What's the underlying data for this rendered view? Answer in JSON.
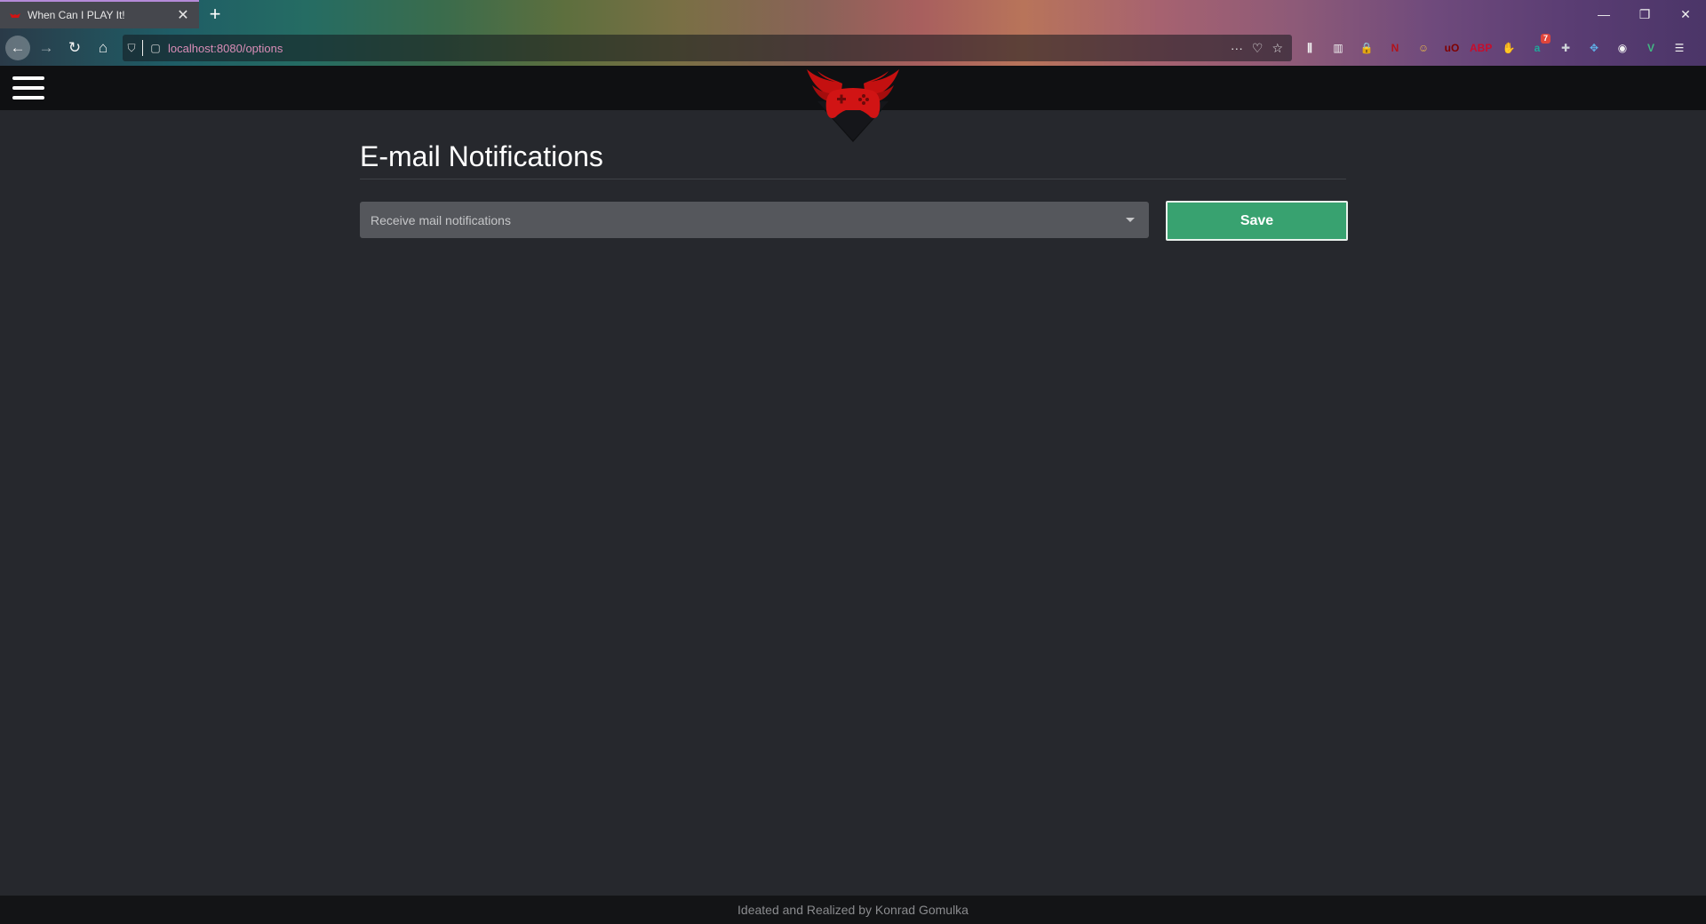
{
  "browser": {
    "tab_title": "When Can I PLAY It!",
    "tab_close": "✕",
    "new_tab": "+",
    "window_controls": {
      "minimize": "—",
      "restore": "❐",
      "close": "✕"
    },
    "nav": {
      "back": "←",
      "forward": "→",
      "reload": "↻",
      "home": "⌂"
    },
    "url": "localhost:8080/options",
    "url_actions": {
      "more": "···",
      "pocket": "♡",
      "bookmark": "☆"
    },
    "extensions": [
      {
        "icon": "library-icon",
        "label": "⫼"
      },
      {
        "icon": "sidebar-icon",
        "label": "▥"
      },
      {
        "icon": "lock-ext-icon",
        "label": "🔒",
        "color": "#e0453b"
      },
      {
        "icon": "netflix-ext-icon",
        "label": "N",
        "color": "#b3131b"
      },
      {
        "icon": "face-ext-icon",
        "label": "☺",
        "color": "#e8b84a"
      },
      {
        "icon": "ublock-icon",
        "label": "uO",
        "color": "#800000"
      },
      {
        "icon": "adblock-plus-icon",
        "label": "ABP",
        "color": "#c70d2c"
      },
      {
        "icon": "hand-ext-icon",
        "label": "✋",
        "color": "#e0453b"
      },
      {
        "icon": "a-ext-icon",
        "label": "a",
        "color": "#1fa89b",
        "badge": "7"
      },
      {
        "icon": "puzzle-ext-icon",
        "label": "✚",
        "color": "#cfd4d9"
      },
      {
        "icon": "gamepad-ext-icon",
        "label": "✥",
        "color": "#5fb0e8"
      },
      {
        "icon": "account-icon",
        "label": "◉"
      },
      {
        "icon": "vue-ext-icon",
        "label": "V",
        "color": "#41b883"
      },
      {
        "icon": "menu-icon",
        "label": "☰"
      }
    ]
  },
  "header": {
    "logo_name": "winged-gamepad-logo",
    "logo_color": "#d11414"
  },
  "page": {
    "title": "E-mail Notifications",
    "select_placeholder": "Receive mail notifications",
    "save_label": "Save",
    "accent": "#38a270"
  },
  "footer": {
    "text": "Ideated and Realized by Konrad Gomulka"
  }
}
